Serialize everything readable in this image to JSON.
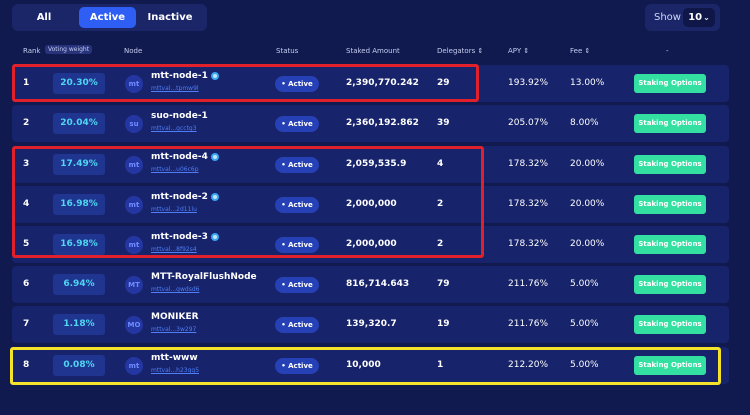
{
  "filters": {
    "tabs": [
      {
        "label": "All",
        "active": false
      },
      {
        "label": "Active",
        "active": true
      },
      {
        "label": "Inactive",
        "active": false
      }
    ]
  },
  "show": {
    "label": "Show",
    "value": "10"
  },
  "headers": {
    "rank": "Rank",
    "voting_weight": "Voting weight",
    "node": "Node",
    "status": "Status",
    "staked": "Staked Amount",
    "delegators": "Delegators ⇕",
    "apy": "APY ⇕",
    "fee": "Fee ⇕",
    "actions": "-"
  },
  "rows": [
    {
      "rank": "1",
      "weight": "20.30%",
      "avatar": "mt",
      "name": "mtt-node-1",
      "verified": true,
      "addr": "mttval...tpmw9l",
      "status": "• Active",
      "staked": "2,390,770.242",
      "delegators": "29",
      "apy": "193.92%",
      "fee": "13.00%",
      "action": "Staking Options"
    },
    {
      "rank": "2",
      "weight": "20.04%",
      "avatar": "su",
      "name": "suo-node-1",
      "verified": false,
      "addr": "mttval...gcctg3",
      "status": "• Active",
      "staked": "2,360,192.862",
      "delegators": "39",
      "apy": "205.07%",
      "fee": "8.00%",
      "action": "Staking Options"
    },
    {
      "rank": "3",
      "weight": "17.49%",
      "avatar": "mt",
      "name": "mtt-node-4",
      "verified": true,
      "addr": "mttval...u06c6p",
      "status": "• Active",
      "staked": "2,059,535.9",
      "delegators": "4",
      "apy": "178.32%",
      "fee": "20.00%",
      "action": "Staking Options"
    },
    {
      "rank": "4",
      "weight": "16.98%",
      "avatar": "mt",
      "name": "mtt-node-2",
      "verified": true,
      "addr": "mttval...2d11lu",
      "status": "• Active",
      "staked": "2,000,000",
      "delegators": "2",
      "apy": "178.32%",
      "fee": "20.00%",
      "action": "Staking Options"
    },
    {
      "rank": "5",
      "weight": "16.98%",
      "avatar": "mt",
      "name": "mtt-node-3",
      "verified": true,
      "addr": "mttval...8f92s4",
      "status": "• Active",
      "staked": "2,000,000",
      "delegators": "2",
      "apy": "178.32%",
      "fee": "20.00%",
      "action": "Staking Options"
    },
    {
      "rank": "6",
      "weight": "6.94%",
      "avatar": "MT",
      "name": "MTT-RoyalFlushNode",
      "verified": false,
      "addr": "mttval...gwdsd6",
      "status": "• Active",
      "staked": "816,714.643",
      "delegators": "79",
      "apy": "211.76%",
      "fee": "5.00%",
      "action": "Staking Options"
    },
    {
      "rank": "7",
      "weight": "1.18%",
      "avatar": "MO",
      "name": "MONIKER",
      "verified": false,
      "addr": "mttval...3w297",
      "status": "• Active",
      "staked": "139,320.7",
      "delegators": "19",
      "apy": "211.76%",
      "fee": "5.00%",
      "action": "Staking Options"
    },
    {
      "rank": "8",
      "weight": "0.08%",
      "avatar": "mt",
      "name": "mtt-www",
      "verified": false,
      "addr": "mttval...h23qg5",
      "status": "• Active",
      "staked": "10,000",
      "delegators": "1",
      "apy": "212.20%",
      "fee": "5.00%",
      "action": "Staking Options"
    }
  ],
  "colors": {
    "background": "#101a4f",
    "row": "#17236a",
    "accent_blue": "#2f5ef5",
    "weight_text": "#4ed6f2",
    "staking_button": "#34e0a1",
    "highlight_red": "#e0202a",
    "highlight_yellow": "#f5e22b"
  },
  "highlights": [
    {
      "color": "red",
      "rows": [
        "1"
      ]
    },
    {
      "color": "red",
      "rows": [
        "3",
        "4",
        "5"
      ]
    },
    {
      "color": "yellow",
      "rows": [
        "8"
      ]
    }
  ]
}
